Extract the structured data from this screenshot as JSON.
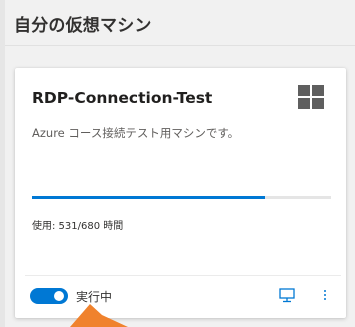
{
  "section": {
    "title": "自分の仮想マシン"
  },
  "vm_card": {
    "name": "RDP-Connection-Test",
    "os_icon": "windows-logo-icon",
    "description": "Azure コース接続テスト用マシンです。",
    "usage": {
      "label": "使用: 531/680 時間",
      "used_hours": 531,
      "total_hours": 680,
      "fraction": 0.78
    },
    "state": {
      "label": "実行中",
      "toggle_on": true
    },
    "actions": {
      "connect_icon": "monitor-connect-icon",
      "more_icon": "more-vertical-icon"
    }
  },
  "colors": {
    "accent": "#0078d4",
    "annotation_arrow": "#f0822d"
  }
}
